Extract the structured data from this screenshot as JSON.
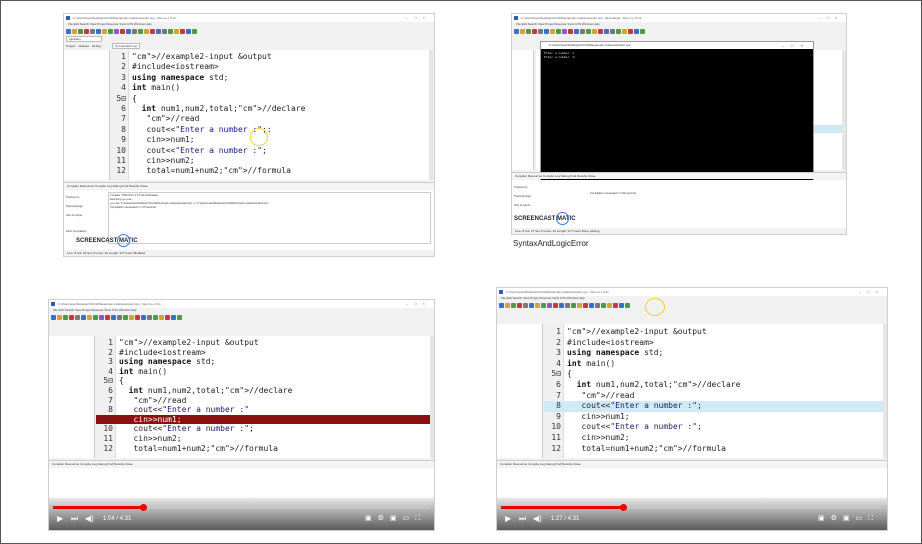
{
  "slides": {
    "tl": {
      "title": "C:\\Users\\user\\Desktop\\CIC1100\\example code\\example2.cpp - Dev-C++ 5.11",
      "menu": "File  Edit  Search  View  Project  Execute  Tools  CVS  Window  Help",
      "globals": "(globals)",
      "panel_tabs": [
        "Project",
        "Classes",
        "Debug"
      ],
      "file_tab": "[*] example2.cpp",
      "code": [
        {
          "n": "1",
          "t": "//example2-input &output"
        },
        {
          "n": "2",
          "t": "#include<iostream>"
        },
        {
          "n": "3",
          "t": "using namespace std;"
        },
        {
          "n": "4",
          "t": "int main()"
        },
        {
          "n": "5",
          "t": "{"
        },
        {
          "n": "6",
          "t": "  int num1,num2,total;//declare"
        },
        {
          "n": "7",
          "t": "   //read"
        },
        {
          "n": "8",
          "t": "   cout<<\"Enter a number :\";:"
        },
        {
          "n": "9",
          "t": "   cin>>num1;"
        },
        {
          "n": "10",
          "t": "   cout<<\"Enter a number :\";"
        },
        {
          "n": "11",
          "t": "   cin>>num2;"
        },
        {
          "n": "12",
          "t": "   total=num1+num2;//formula"
        }
      ],
      "bottom_tabs": "Compiler   Resources   Compile Log   Debug   Find Results   Close",
      "compile_log": [
        "Compiler: TDM-GCC 4.9.2 64-bit Release",
        "Executing g++.exe...",
        "g++.exe \"C:\\Users\\user\\Desktop\\CIC1100\\example code\\example2.cpp\" -o \"C:\\Users\\user\\Desktop\\CIC1100\\example code\\example2.exe\"",
        "Compilation succeeded in 2.15 seconds"
      ],
      "abort": "Abort Compilation",
      "status": "Line: 8   Col: 26   Sel: 0   Lines: 16   Length: 377   Insert   Modified"
    },
    "tr": {
      "title": "C:\\Users\\user\\Desktop\\CIC1100\\example code\\example2.cpp - [Executing] - Dev-C++ 5.11",
      "console_title": "C:\\Users\\user\\Desktop\\CIC1100\\example code\\example2.exe",
      "console_output": "Enter a number :1\nEnter a number :2",
      "compile_log": "Compilation succeeded in 0.56 seconds",
      "status": "Line: 8   Col: 27   Sel: 0   Lines: 16   Length: 377   Insert   Done parsing",
      "caption": "SyntaxAndLogicError"
    },
    "bl": {
      "title": "C:\\Users\\user\\Desktop\\CIC1100\\example code\\example2.cpp - Dev-C++ 5.11",
      "code": [
        {
          "n": "1",
          "t": "//example2-input &output"
        },
        {
          "n": "2",
          "t": "#include<iostream>"
        },
        {
          "n": "3",
          "t": "using namespace std;"
        },
        {
          "n": "4",
          "t": "int main()"
        },
        {
          "n": "5",
          "t": "{"
        },
        {
          "n": "6",
          "t": "  int num1,num2,total;//declare"
        },
        {
          "n": "7",
          "t": "   //read"
        },
        {
          "n": "8",
          "t": "   cout<<\"Enter a number :\""
        },
        {
          "n": "9",
          "t": "   cin>>num1;"
        },
        {
          "n": "10",
          "t": "   cout<<\"Enter a number :\";"
        },
        {
          "n": "11",
          "t": "   cin>>num2;"
        },
        {
          "n": "12",
          "t": "   total=num1+num2;//formula"
        }
      ],
      "time": "1:04 / 4:31",
      "progress": 0.24
    },
    "br": {
      "title": "C:\\Users\\user\\Desktop\\CIC1100\\example code\\example2.cpp - Dev-C++ 5.11",
      "code": [
        {
          "n": "1",
          "t": "//example2-input &output"
        },
        {
          "n": "2",
          "t": "#include<iostream>"
        },
        {
          "n": "3",
          "t": "using namespace std;"
        },
        {
          "n": "4",
          "t": "int main()"
        },
        {
          "n": "5",
          "t": "{"
        },
        {
          "n": "6",
          "t": "  int num1,num2,total;//declare"
        },
        {
          "n": "7",
          "t": "   //read"
        },
        {
          "n": "8",
          "t": "   cout<<\"Enter a number :\";"
        },
        {
          "n": "9",
          "t": "   cin>>num1;"
        },
        {
          "n": "10",
          "t": "   cout<<\"Enter a number :\";"
        },
        {
          "n": "11",
          "t": "   cin>>num2;"
        },
        {
          "n": "12",
          "t": "   total=num1+num2;//formula"
        }
      ],
      "time": "1:27 / 4:31",
      "progress": 0.32
    }
  },
  "colors": {
    "highlight": "#cfeaf5",
    "error_line": "#8b1010",
    "progress": "#ee0000",
    "annotation_yellow": "#f2d22e"
  }
}
